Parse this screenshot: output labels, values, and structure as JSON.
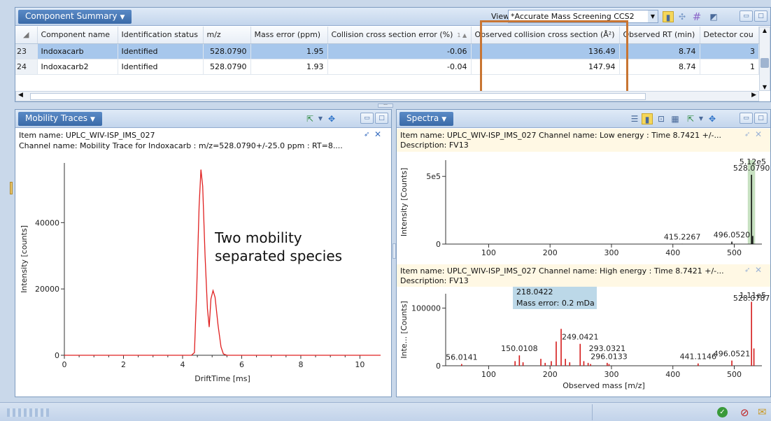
{
  "summary": {
    "title": "Component Summary",
    "view_label": "View:",
    "view_value": "*Accurate Mass Screening CCS2",
    "columns": [
      "Component name",
      "Identification status",
      "m/z",
      "Mass error (ppm)",
      "Collision cross section error (%)",
      "Observed collision cross section (Å²)",
      "Observed RT (min)",
      "Detector cou"
    ],
    "sort_indicator": "1 ▲",
    "rows": [
      {
        "n": "23",
        "name": "Indoxacarb",
        "status": "Identified",
        "mz": "528.0790",
        "ppm": "1.95",
        "ccs_err": "-0.06",
        "ccs": "136.49",
        "rt": "8.74",
        "det": "3"
      },
      {
        "n": "24",
        "name": "Indoxacarb2",
        "status": "Identified",
        "mz": "528.0790",
        "ppm": "1.93",
        "ccs_err": "-0.04",
        "ccs": "147.94",
        "rt": "8.74",
        "det": "1"
      }
    ],
    "highlight_color": "#c87533"
  },
  "mobility": {
    "title": "Mobility Traces",
    "item_line": "Item name: UPLC_WIV-ISP_IMS_027",
    "channel_line": "Channel name: Mobility Trace for Indoxacarb : m/z=528.0790+/-25.0 ppm : RT=8....",
    "annotation_1": "Two mobility",
    "annotation_2": "separated species",
    "chart_data": {
      "type": "line",
      "xlabel": "DriftTime [ms]",
      "ylabel": "Intensity [counts]",
      "xlim": [
        0,
        10.7
      ],
      "ylim": [
        0,
        58000
      ],
      "x_ticks": [
        "0",
        "2",
        "4",
        "6",
        "8",
        "10"
      ],
      "y_ticks": [
        "0",
        "20000",
        "40000"
      ],
      "color": "#e02020",
      "points": [
        [
          0,
          0
        ],
        [
          4.3,
          0
        ],
        [
          4.4,
          800
        ],
        [
          4.48,
          20000
        ],
        [
          4.56,
          45000
        ],
        [
          4.62,
          56000
        ],
        [
          4.68,
          51000
        ],
        [
          4.76,
          30000
        ],
        [
          4.84,
          14000
        ],
        [
          4.9,
          8500
        ],
        [
          4.96,
          17000
        ],
        [
          5.03,
          19500
        ],
        [
          5.1,
          17500
        ],
        [
          5.2,
          9000
        ],
        [
          5.3,
          2500
        ],
        [
          5.38,
          400
        ],
        [
          5.5,
          0
        ],
        [
          10.7,
          0
        ]
      ]
    }
  },
  "spectra": {
    "title": "Spectra",
    "low": {
      "item_line": "Item name: UPLC_WIV-ISP_IMS_027   Channel name: Low energy : Time 8.7421 +/-...",
      "desc": "Description: FV13",
      "chart_data": {
        "type": "bar",
        "xlabel": "",
        "ylabel": "Intensity [Counts]",
        "xlim": [
          30,
          545
        ],
        "ylim": [
          0,
          620000
        ],
        "x_ticks": [
          "100",
          "200",
          "300",
          "400",
          "500"
        ],
        "y_ticks": [
          "0",
          "5e5"
        ],
        "max_label": "5.12e5",
        "peaks": [
          [
            415.2267,
            2000
          ],
          [
            496.052,
            18000
          ],
          [
            528.079,
            512000
          ],
          [
            530.08,
            60000
          ]
        ],
        "peak_labels": [
          [
            "528.0790",
            528.079,
            512000
          ],
          [
            "415.2267",
            415.2267,
            2000
          ],
          [
            "496.0520",
            496.052,
            18000
          ]
        ]
      }
    },
    "high": {
      "item_line": "Item name: UPLC_WIV-ISP_IMS_027   Channel name: High energy : Time 8.7421 +/-...",
      "desc": "Description: FV13",
      "tooltip_1": "218.0422",
      "tooltip_2": "Mass error: 0.2 mDa",
      "chart_data": {
        "type": "bar",
        "xlabel": "Observed mass [m/z]",
        "ylabel": "Inte... [Counts]",
        "xlim": [
          30,
          545
        ],
        "ylim": [
          0,
          125000
        ],
        "x_ticks": [
          "100",
          "200",
          "300",
          "400",
          "500"
        ],
        "y_ticks": [
          "0",
          "100000"
        ],
        "max_label": "1.11e5",
        "peaks": [
          [
            56.0141,
            3000
          ],
          [
            143,
            8000
          ],
          [
            150.0108,
            18000
          ],
          [
            156,
            6000
          ],
          [
            185,
            12000
          ],
          [
            192,
            5000
          ],
          [
            202,
            8000
          ],
          [
            210,
            42000
          ],
          [
            218.0422,
            64000
          ],
          [
            225,
            12000
          ],
          [
            232,
            6000
          ],
          [
            249.0421,
            38000
          ],
          [
            255,
            8000
          ],
          [
            262,
            5000
          ],
          [
            266,
            3000
          ],
          [
            293.0321,
            5000
          ],
          [
            296.0133,
            3000
          ],
          [
            441.1146,
            4000
          ],
          [
            496.0521,
            9000
          ],
          [
            528.0787,
            111000
          ],
          [
            532,
            30000
          ]
        ],
        "peak_labels": [
          [
            "56.0141",
            56.0141,
            3000
          ],
          [
            "150.0108",
            150.0108,
            18000
          ],
          [
            "249.0421",
            249.0421,
            38000
          ],
          [
            "293.0321",
            293.0321,
            18000
          ],
          [
            "296.0133",
            296.0133,
            4000
          ],
          [
            "441.1146",
            441.1146,
            4000
          ],
          [
            "496.0521",
            496.0521,
            9000
          ],
          [
            "528.0787",
            528.0787,
            111000
          ]
        ]
      }
    }
  }
}
